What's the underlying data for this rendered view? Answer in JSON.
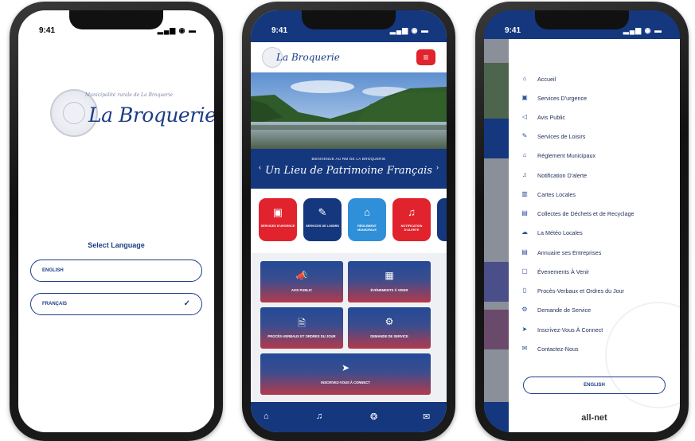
{
  "status": {
    "time": "9:41",
    "signal": "▂▄▆ ◉ ▬"
  },
  "phone1": {
    "logo_small": "Municipalité rurale de La Broquerie",
    "logo_big": "La Broquerie",
    "select_language": "Select Language",
    "english": "ENGLISH",
    "francais": "FRANÇAIS",
    "check": "✓"
  },
  "phone2": {
    "logo": "La Broquerie",
    "menu_icon": "≡",
    "banner_sub": "BIENVENUE AU RM DE LA BROQUERIE",
    "banner_title": "Un Lieu de Patrimoine Français",
    "tiles": [
      {
        "label": "SERVICES D'URGENCE",
        "icon": "▣",
        "color": "#e0232d"
      },
      {
        "label": "SERVICES DE LOISIRS",
        "icon": "✎",
        "color": "#14377e"
      },
      {
        "label": "RÈGLEMENT MUNICIPAUX",
        "icon": "⌂",
        "color": "#2f8fd8"
      },
      {
        "label": "NOTIFICATION D'ALERTE",
        "icon": "♫",
        "color": "#e0232d"
      }
    ],
    "cards": [
      {
        "label": "AVIS PUBLIC",
        "icon": "📣"
      },
      {
        "label": "ÉVÉNEMENTS À VENIR",
        "icon": "▦"
      },
      {
        "label": "PROCÈS-VERBAUX ET ORDRES DU JOUR",
        "icon": "🗎"
      },
      {
        "label": "DEMANDE DE SERVICE",
        "icon": "⚙"
      },
      {
        "label": "INSCRIVEZ-VOUS À CONNECT",
        "icon": "➤"
      }
    ],
    "bottom_nav": [
      "⌂",
      "♫",
      "❂",
      "✉"
    ]
  },
  "phone3": {
    "menu": [
      {
        "label": "Accueil",
        "icon": "⌂"
      },
      {
        "label": "Services D'urgence",
        "icon": "▣"
      },
      {
        "label": "Avis Public",
        "icon": "◁"
      },
      {
        "label": "Services de Loisirs",
        "icon": "✎"
      },
      {
        "label": "Réglement Municipaux",
        "icon": "⌂"
      },
      {
        "label": "Notification D'alerte",
        "icon": "♫"
      },
      {
        "label": "Cartes Locales",
        "icon": "▥"
      },
      {
        "label": "Collectes de Déchets et de Recyclage",
        "icon": "▤"
      },
      {
        "label": "La Météo Locales",
        "icon": "☁"
      },
      {
        "label": "Annuaire ses Entreprises",
        "icon": "▤"
      },
      {
        "label": "Évenements À Venir",
        "icon": "▢"
      },
      {
        "label": "Procès-Verbaux et Ordres du Jour",
        "icon": "▯"
      },
      {
        "label": "Demande de Service",
        "icon": "⚙"
      },
      {
        "label": "Inscrivez-Vous À Connect",
        "icon": "➤"
      },
      {
        "label": "Contactez-Nous",
        "icon": "✉"
      }
    ],
    "english_button": "ENGLISH",
    "footer_logo": "all-net"
  }
}
